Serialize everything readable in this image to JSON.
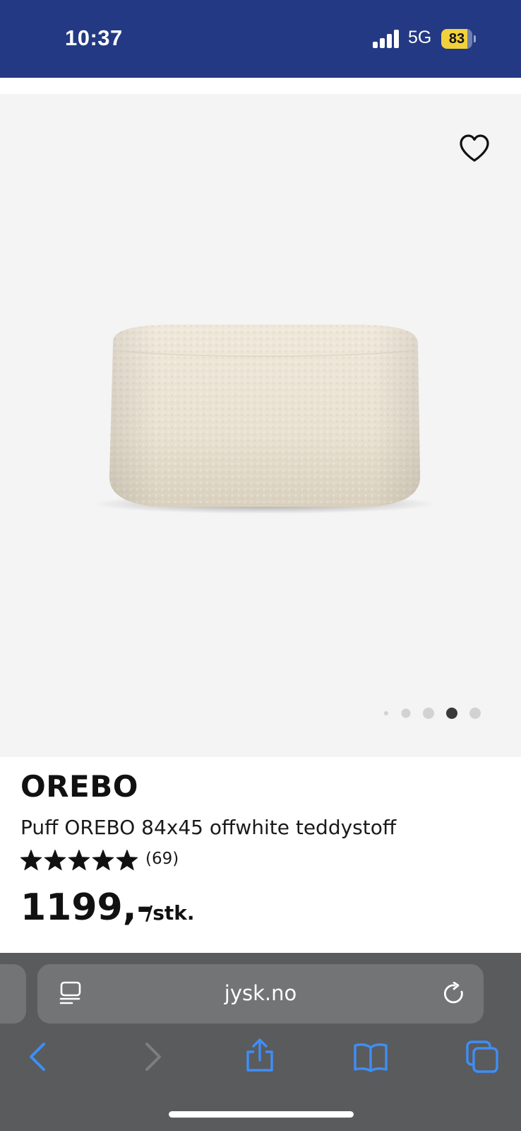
{
  "status_bar": {
    "time": "10:37",
    "network": "5G",
    "battery_percent": "83",
    "battery_level": 0.83,
    "background_color": "#233984"
  },
  "product_gallery": {
    "favorite_icon": "heart-outline-icon",
    "image_count": 5,
    "active_index": 3
  },
  "product": {
    "brand": "OREBO",
    "name": "Puff OREBO 84x45 offwhite teddystoff",
    "rating": 5,
    "rating_max": 5,
    "review_count": "(69)",
    "price": "1199,-",
    "unit": "/stk."
  },
  "browser": {
    "url": "jysk.no",
    "reader_icon": "page-menu-icon",
    "reload_icon": "reload-icon",
    "toolbar": [
      "back-icon",
      "forward-icon",
      "share-icon",
      "bookmarks-icon",
      "tabs-icon"
    ],
    "accent_color": "#3e8ef7"
  }
}
